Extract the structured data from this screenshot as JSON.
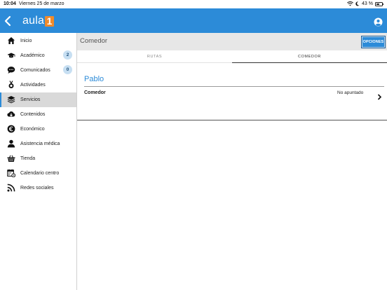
{
  "status_bar": {
    "time": "10:04",
    "date": "Viernes 25 de marzo",
    "battery": "43 %"
  },
  "nav": {
    "logo_text": "aula",
    "logo_mark": "1",
    "brand_color": "#2c8bd8",
    "logo_accent": "#f08a2a"
  },
  "sidebar": {
    "items": [
      {
        "label": "Inicio",
        "icon": "home-icon"
      },
      {
        "label": "Académico",
        "icon": "graduation-cap-icon",
        "badge": "2"
      },
      {
        "label": "Comunicados",
        "icon": "chat-bubble-icon",
        "badge": "0"
      },
      {
        "label": "Actividades",
        "icon": "medal-icon"
      },
      {
        "label": "Servicios",
        "icon": "layers-icon",
        "active": true
      },
      {
        "label": "Contenidos",
        "icon": "cloud-download-icon"
      },
      {
        "label": "Económico",
        "icon": "euro-icon"
      },
      {
        "label": "Asistencia médica",
        "icon": "user-icon"
      },
      {
        "label": "Tienda",
        "icon": "basket-icon"
      },
      {
        "label": "Calendario centro",
        "icon": "calendar-icon"
      },
      {
        "label": "Redes sociales",
        "icon": "rss-icon"
      }
    ]
  },
  "header": {
    "title": "Comedor",
    "options_label": "OPCIONES"
  },
  "tabs": [
    {
      "label": "RUTAS",
      "active": false
    },
    {
      "label": "COMEDOR",
      "active": true
    }
  ],
  "content": {
    "child_name": "Pablo",
    "services": [
      {
        "name": "Comedor",
        "status": "No apuntado"
      }
    ]
  }
}
